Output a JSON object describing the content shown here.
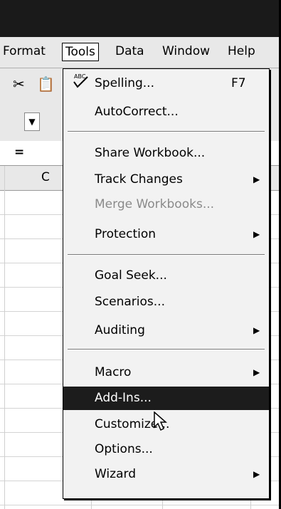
{
  "menubar": {
    "format": "Format",
    "tools": "Tools",
    "data": "Data",
    "window": "Window",
    "help": "Help"
  },
  "formula_bar": {
    "equals": "="
  },
  "column_header": {
    "c": "C"
  },
  "tools_menu": {
    "items": [
      {
        "label": "Spelling...",
        "shortcut": "F7"
      },
      {
        "label": "AutoCorrect..."
      },
      {
        "label": "Share Workbook..."
      },
      {
        "label": "Track Changes"
      },
      {
        "label": "Merge Workbooks...",
        "disabled": true
      },
      {
        "label": "Protection"
      },
      {
        "label": "Goal Seek..."
      },
      {
        "label": "Scenarios..."
      },
      {
        "label": "Auditing"
      },
      {
        "label": "Macro"
      },
      {
        "label": "Add-Ins...",
        "highlighted": true
      },
      {
        "label": "Customize..."
      },
      {
        "label": "Options..."
      },
      {
        "label": "Wizard"
      }
    ]
  },
  "icons": {
    "cut": "scissors-icon",
    "paste": "paste-icon",
    "spelling": "spelling-check-icon",
    "submenu": "right-arrow-icon",
    "cursor": "mouse-pointer-icon"
  },
  "colors": {
    "titlebar": "#1a1a1a",
    "highlight": "#1c1c1c",
    "menu_bg": "#f2f2f2",
    "disabled": "#8a8a8a"
  }
}
